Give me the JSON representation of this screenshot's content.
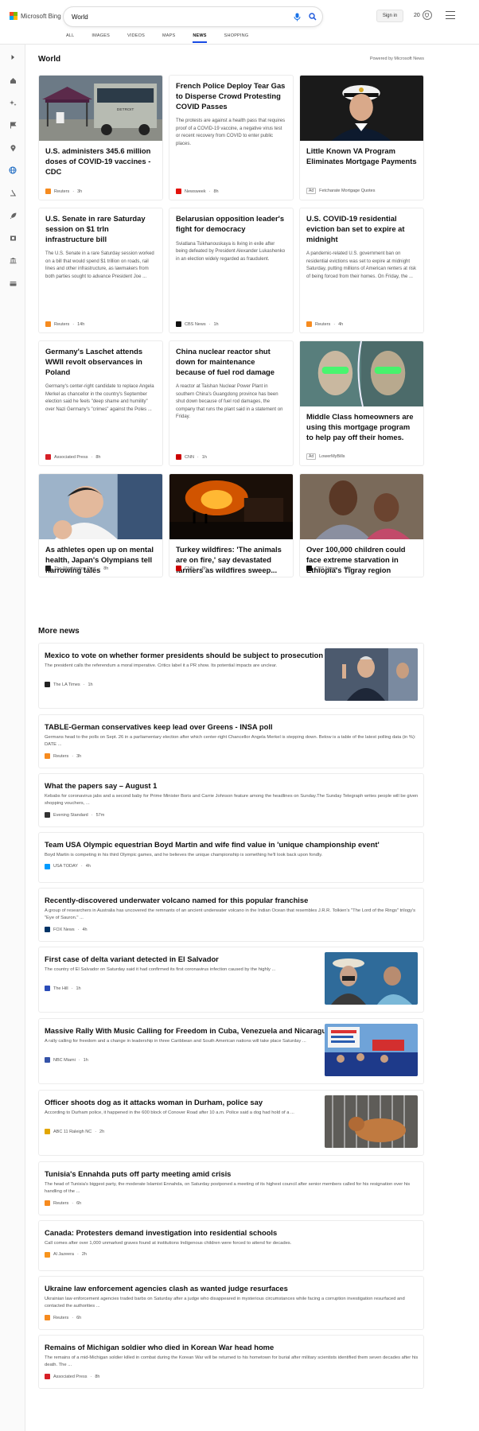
{
  "header": {
    "brand": "Microsoft Bing",
    "query": "World",
    "sign_in": "Sign in",
    "reward_points": "20",
    "tabs": [
      {
        "label": "ALL",
        "active": false
      },
      {
        "label": "IMAGES",
        "active": false
      },
      {
        "label": "VIDEOS",
        "active": false
      },
      {
        "label": "MAPS",
        "active": false
      },
      {
        "label": "NEWS",
        "active": true
      },
      {
        "label": "SHOPPING",
        "active": false
      }
    ]
  },
  "rail": {
    "icons": [
      "chevron-right-icon",
      "home-icon",
      "sparkles-icon",
      "flag-icon",
      "location-pin-icon",
      "globe-icon",
      "microscope-icon",
      "rocket-icon",
      "film-icon",
      "building-icon",
      "card-icon"
    ]
  },
  "world": {
    "title": "World",
    "powered_by": "Powered by Microsoft News",
    "cards": [
      {
        "title": "U.S. administers 345.6 million doses of COVID-19 vaccines - CDC",
        "snippet": "",
        "source": "Reuters",
        "time": "3h",
        "ad": false,
        "image": "vaccine-site"
      },
      {
        "title": "French Police Deploy Tear Gas to Disperse Crowd Protesting COVID Passes",
        "snippet": "The protests are against a health pass that requires proof of a COVID-19 vaccine, a negative virus test or recent recovery from COVID to enter public places.",
        "source": "Newsweek",
        "time": "8h",
        "ad": false,
        "image": ""
      },
      {
        "title": "Little Known VA Program Eliminates Mortgage Payments",
        "snippet": "",
        "source": "Fetcharate Mortgage Quotes",
        "time": "",
        "ad": true,
        "ad_label": "Ad",
        "image": "officer"
      },
      {
        "title": "U.S. Senate in rare Saturday session on $1 trln infrastructure bill",
        "snippet": "The U.S. Senate in a rare Saturday session worked on a bill that would spend $1 trillion on roads, rail lines and other infrastructure, as lawmakers from both parties sought to advance President Joe ...",
        "source": "Reuters",
        "time": "14h",
        "ad": false,
        "image": ""
      },
      {
        "title": "Belarusian opposition leader's fight for democracy",
        "snippet": "Sviatlana Tsikhanouskaya is living in exile after being defeated by President Alexander Lukashenko in an election widely regarded as fraudulent.",
        "source": "CBS News",
        "time": "1h",
        "ad": false,
        "image": ""
      },
      {
        "title": "U.S. COVID-19 residential eviction ban set to expire at midnight",
        "snippet": "A pandemic-related U.S. government ban on residential evictions was set to expire at midnight Saturday, putting millions of American renters at risk of being forced from their homes. On Friday, the ...",
        "source": "Reuters",
        "time": "4h",
        "ad": false,
        "image": ""
      },
      {
        "title": "Germany's Laschet attends WWII revolt observances in Poland",
        "snippet": "Germany's center-right candidate to replace Angela Merkel as chancellor in the country's September election said he feels \"deep shame and humility\" over Nazi Germany's \"crimes\" against the Poles ...",
        "source": "Associated Press",
        "time": "8h",
        "ad": false,
        "image": ""
      },
      {
        "title": "China nuclear reactor shut down for maintenance because of fuel rod damage",
        "snippet": "A reactor at Taishan Nuclear Power Plant in southern China's Guangdong province has been shut down because of fuel rod damages, the company that runs the plant said in a statement on Friday.",
        "source": "CNN",
        "time": "1h",
        "ad": false,
        "image": ""
      },
      {
        "title": "Middle Class homeowners are using this mortgage program to help pay off their homes.",
        "snippet": "",
        "source": "LowerMyBills",
        "time": "",
        "ad": true,
        "ad_label": "Ad",
        "image": "green-faces"
      },
      {
        "title": "As athletes open up on mental health, Japan's Olympians tell harrowing tales",
        "snippet": "",
        "source": "The Washington Post",
        "time": "8h",
        "ad": false,
        "image": "athlete"
      },
      {
        "title": "Turkey wildfires: 'The animals are on fire,' say devastated farmers as wildfires sweep...",
        "snippet": "",
        "source": "CNN",
        "time": "8h",
        "ad": false,
        "image": "wildfire"
      },
      {
        "title": "Over 100,000 children could face extreme starvation in Ethiopia's Tigray region",
        "snippet": "",
        "source": "CBS News",
        "time": "10h",
        "ad": false,
        "image": "mother-child"
      }
    ]
  },
  "more_news": {
    "title": "More news",
    "items": [
      {
        "title": "Mexico to vote on whether former presidents should be subject to prosecution",
        "snippet": "The president calls the referendum a moral imperative. Critics label it a PR show. Its potential impacts are unclear.",
        "source": "The LA Times",
        "time": "1h",
        "image": "president"
      },
      {
        "title": "TABLE-German conservatives keep lead over Greens - INSA poll",
        "snippet": "Germans head to the polls on Sept. 26 in a parliamentary election after which center-right Chancellor Angela Merkel is stepping down. Below is a table of the latest polling data (in %): DATE ...",
        "source": "Reuters",
        "time": "3h",
        "image": ""
      },
      {
        "title": "What the papers say – August 1",
        "snippet": "Kebabs for coronavirus jabs and a second baby for Prime Minister Boris and Carrie Johnson feature among the headlines on Sunday.The Sunday Telegraph writes people will be given shopping vouchers, ...",
        "source": "Evening Standard",
        "time": "57m",
        "image": ""
      },
      {
        "title": "Team USA Olympic equestrian Boyd Martin and wife find value in 'unique championship event'",
        "snippet": "Boyd Martin is competing in his third Olympic games, and he believes the unique championship is something he'll look back upon fondly.",
        "source": "USA TODAY",
        "time": "4h",
        "image": ""
      },
      {
        "title": "Recently-discovered underwater volcano named for this popular franchise",
        "snippet": "A group of researchers in Australia has uncovered the remnants of an ancient underwater volcano in the Indian Ocean that resembles J.R.R. Tolkien's \"The Lord of the Rings\" trilogy's \"Eye of Sauron.\" ...",
        "source": "FOX News",
        "time": "4h",
        "image": ""
      },
      {
        "title": "First case of delta variant detected in El Salvador",
        "snippet": "The country of El Salvador on Saturday said it had confirmed its first coronavirus infection caused by the highly ...",
        "source": "The Hill",
        "time": "1h",
        "image": "vaccination"
      },
      {
        "title": "Massive Rally With Music Calling for Freedom in Cuba, Venezuela and Nicaragua",
        "snippet": "A rally calling for freedom and a change in leadership in three Caribbean and South American nations will take place Saturday ...",
        "source": "NBC Miami",
        "time": "1h",
        "image": "rally"
      },
      {
        "title": "Officer shoots dog as it attacks woman in Durham, police say",
        "snippet": "According to Durham police, it happened in the 600 block of Conover Road after 10 a.m. Police said a dog had hold of a ...",
        "source": "ABC 11 Raleigh NC",
        "time": "2h",
        "image": "dog"
      },
      {
        "title": "Tunisia's Ennahda puts off party meeting amid crisis",
        "snippet": "The head of Tunisia's biggest party, the moderate Islamist Ennahda, on Saturday postponed a meeting of its highest council after senior members called for his resignation over his handling of the ...",
        "source": "Reuters",
        "time": "6h",
        "image": ""
      },
      {
        "title": "Canada: Protesters demand investigation into residential schools",
        "snippet": "Call comes after over 1,000 unmarked graves found at institutions Indigenous children were forced to attend for decades.",
        "source": "Al Jazeera",
        "time": "2h",
        "image": ""
      },
      {
        "title": "Ukraine law enforcement agencies clash as wanted judge resurfaces",
        "snippet": "Ukrainian law enforcement agencies traded barbs on Saturday after a judge who disappeared in mysterious circumstances while facing a corruption investigation resurfaced and contacted the authorities ...",
        "source": "Reuters",
        "time": "6h",
        "image": ""
      },
      {
        "title": "Remains of Michigan soldier who died in Korean War head home",
        "snippet": "The remains of a mid-Michigan soldier killed in combat during the Korean War will be returned to his hometown for burial after military scientists identified them seven decades after his death. The ...",
        "source": "Associated Press",
        "time": "8h",
        "image": ""
      }
    ]
  },
  "source_colors": {
    "Reuters": "#f68b1f",
    "Newsweek": "#e3120b",
    "CBS News": "#111111",
    "Associated Press": "#d61f26",
    "CNN": "#cc0000",
    "The Washington Post": "#222222",
    "The LA Times": "#222222",
    "Evening Standard": "#333333",
    "USA TODAY": "#009bff",
    "FOX News": "#003366",
    "The Hill": "#2a4cb8",
    "NBC Miami": "#3553a8",
    "ABC 11 Raleigh NC": "#e2a600",
    "Al Jazeera": "#f7941d",
    "Fetcharate Mortgage Quotes": "#888888",
    "LowerMyBills": "#888888"
  },
  "accent_color": "#174ae4"
}
